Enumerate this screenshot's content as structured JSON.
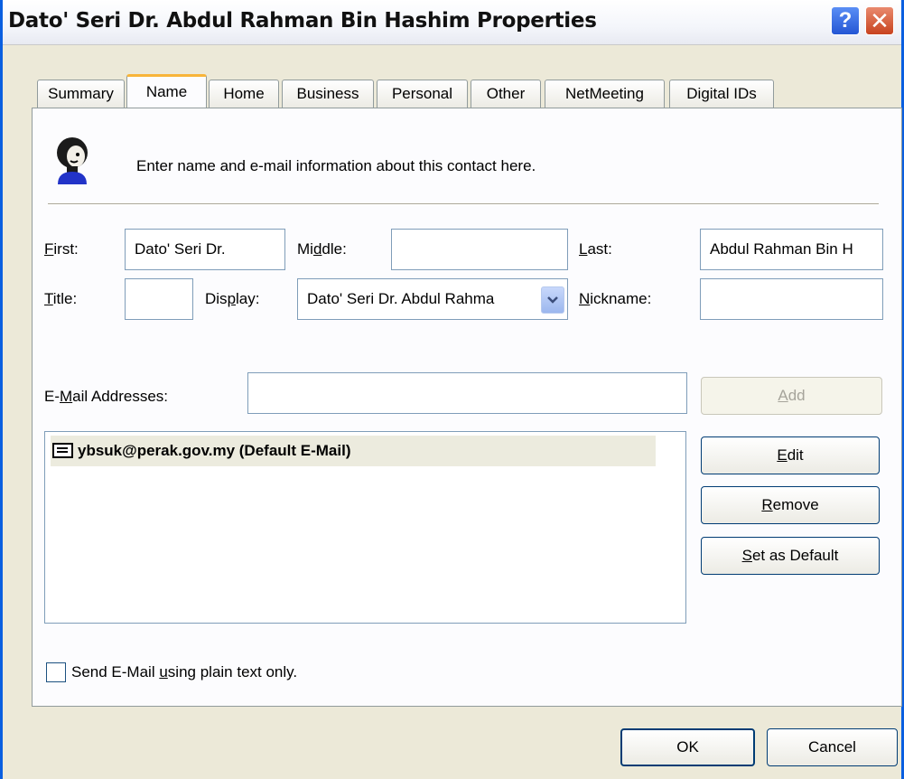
{
  "window": {
    "title": "Dato' Seri Dr. Abdul Rahman Bin Hashim Properties",
    "help_glyph": "?",
    "close_glyph": "✕"
  },
  "tabs": [
    {
      "label": "Summary"
    },
    {
      "label": "Name"
    },
    {
      "label": "Home"
    },
    {
      "label": "Business"
    },
    {
      "label": "Personal"
    },
    {
      "label": "Other"
    },
    {
      "label": "NetMeeting"
    },
    {
      "label": "Digital IDs"
    }
  ],
  "active_tab": "Name",
  "intro_text": "Enter name and e-mail information about this contact here.",
  "name": {
    "first_label_key": "F",
    "first_label_rest": "irst:",
    "first_value": "Dato' Seri Dr.",
    "middle_label_a": "Mi",
    "middle_label_key": "d",
    "middle_label_b": "dle:",
    "middle_value": "",
    "last_label_key": "L",
    "last_label_rest": "ast:",
    "last_value": "Abdul Rahman Bin H",
    "title_label_key": "T",
    "title_label_rest": "itle:",
    "title_value": "",
    "display_label_a": "Dis",
    "display_label_key": "p",
    "display_label_b": "lay:",
    "display_value": "Dato' Seri Dr. Abdul Rahma",
    "nickname_label_key": "N",
    "nickname_label_rest": "ickname:",
    "nickname_value": ""
  },
  "email": {
    "label_a": "E-",
    "label_key": "M",
    "label_b": "ail Addresses:",
    "input_value": "",
    "add_key": "A",
    "add_rest": "dd",
    "list": [
      {
        "address": "ybsuk@perak.gov.my  (Default E-Mail)"
      }
    ],
    "edit_key": "E",
    "edit_rest": "dit",
    "remove_key": "R",
    "remove_rest": "emove",
    "set_default_key": "S",
    "set_default_rest": "et as Default"
  },
  "plain_text": {
    "label_a": "Send E-Mail ",
    "label_key": "u",
    "label_b": "sing plain text only.",
    "checked": false
  },
  "footer": {
    "ok": "OK",
    "cancel": "Cancel"
  },
  "colors": {
    "accent_border": "#0a5fe0",
    "tab_highlight": "#f8b53a",
    "selection": "#ecebde"
  }
}
